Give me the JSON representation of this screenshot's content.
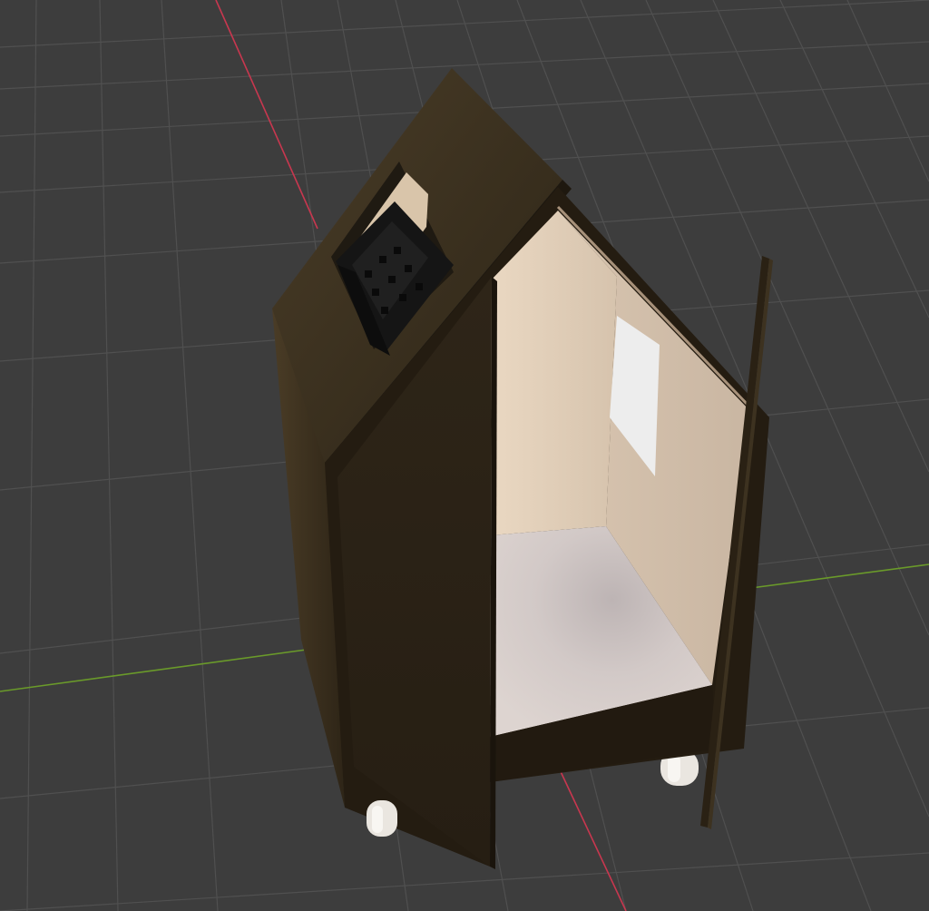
{
  "viewport": {
    "kind": "3d-viewport",
    "background_color": "#3d3d3d",
    "grid_color": "#505050",
    "x_axis_color": "#c8374f",
    "y_axis_color": "#6a9a2a"
  },
  "scene": {
    "object": "small-house-cabinet-on-casters",
    "roof_color": "#3a2f1f",
    "wall_color": "#3b3020",
    "interior_wall_color": "#d9c7b3",
    "interior_floor_color": "#cfc6c4",
    "door_color": "#30271b",
    "caster_color": "#f0ece6",
    "bracket_color": "#161616",
    "window_color": "#ececec"
  }
}
